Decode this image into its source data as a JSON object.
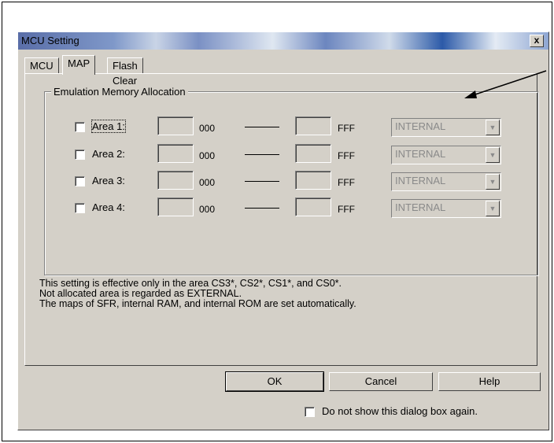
{
  "dialog": {
    "title": "MCU Setting",
    "close_glyph": "x"
  },
  "tabs": [
    {
      "label": "MCU"
    },
    {
      "label": "MAP"
    },
    {
      "label": "Flash Clear"
    }
  ],
  "group": {
    "legend": "Emulation Memory Allocation",
    "rows": [
      {
        "label": "Area 1:",
        "start_suffix": "000",
        "end_suffix": "FFF",
        "select": "INTERNAL"
      },
      {
        "label": "Area 2:",
        "start_suffix": "000",
        "end_suffix": "FFF",
        "select": "INTERNAL"
      },
      {
        "label": "Area 3:",
        "start_suffix": "000",
        "end_suffix": "FFF",
        "select": "INTERNAL"
      },
      {
        "label": "Area 4:",
        "start_suffix": "000",
        "end_suffix": "FFF",
        "select": "INTERNAL"
      }
    ]
  },
  "notes": [
    "This setting is effective only in the area CS3*, CS2*, CS1*, and CS0*.",
    "Not allocated area is regarded as EXTERNAL.",
    "The maps of SFR, internal RAM, and internal ROM are set automatically."
  ],
  "buttons": {
    "ok": "OK",
    "cancel": "Cancel",
    "help": "Help"
  },
  "footer": {
    "dont_show": "Do not show this dialog box again."
  }
}
